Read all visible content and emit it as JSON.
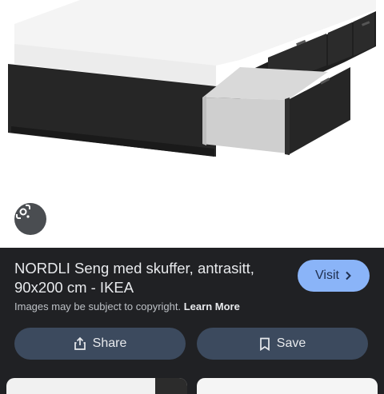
{
  "result": {
    "title": "NORDLI Seng med skuffer, antrasitt, 90x200 cm - IKEA",
    "visit_label": "Visit",
    "copyright_text": "Images may be subject to copyright.",
    "learn_more_label": "Learn More"
  },
  "actions": {
    "share_label": "Share",
    "save_label": "Save"
  },
  "icons": {
    "lens": "google-lens-icon",
    "visit": "chevron-right-icon",
    "share": "share-icon",
    "save": "bookmark-icon"
  },
  "colors": {
    "panel_bg": "#202124",
    "visit_button": "#8ab4f8",
    "action_button": "#3c4a5e"
  }
}
